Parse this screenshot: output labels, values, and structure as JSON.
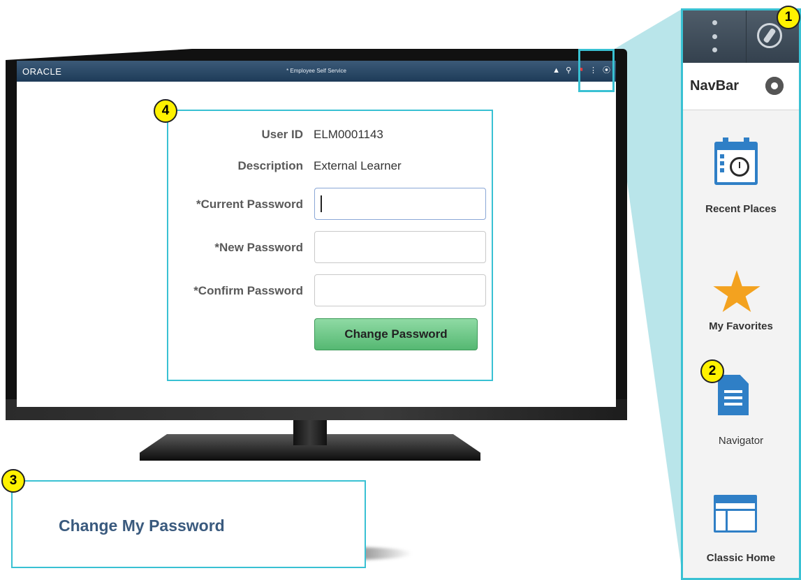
{
  "app": {
    "brand": "ORACLE",
    "window_title": "* Employee Self Service"
  },
  "header_icons": [
    "home-icon",
    "search-icon",
    "notifications-flag-icon",
    "kebab-menu-icon",
    "compass-navbar-icon"
  ],
  "form": {
    "user_id_label": "User ID",
    "user_id_value": "ELM0001143",
    "description_label": "Description",
    "description_value": "External Learner",
    "current_password_label": "*Current Password",
    "current_password_value": "",
    "new_password_label": "*New Password",
    "new_password_value": "",
    "confirm_password_label": "*Confirm Password",
    "confirm_password_value": "",
    "submit_label": "Change Password"
  },
  "callouts": {
    "badge_1": "1",
    "badge_2": "2",
    "badge_3": "3",
    "badge_4": "4",
    "change_my_password_link": "Change My Password"
  },
  "navbar": {
    "title": "NavBar",
    "items": [
      {
        "label": "Recent Places",
        "icon": "calendar-clock-icon"
      },
      {
        "label": "My Favorites",
        "icon": "star-icon"
      },
      {
        "label": "Navigator",
        "icon": "document-icon"
      },
      {
        "label": "Classic Home",
        "icon": "window-icon"
      }
    ]
  },
  "colors": {
    "highlight": "#39c1d3",
    "badge": "#fff200",
    "oracle_bar": "#1e3b58",
    "button_green": "#55b872",
    "icon_blue": "#2f7fc6",
    "star_orange": "#f3a21f"
  }
}
